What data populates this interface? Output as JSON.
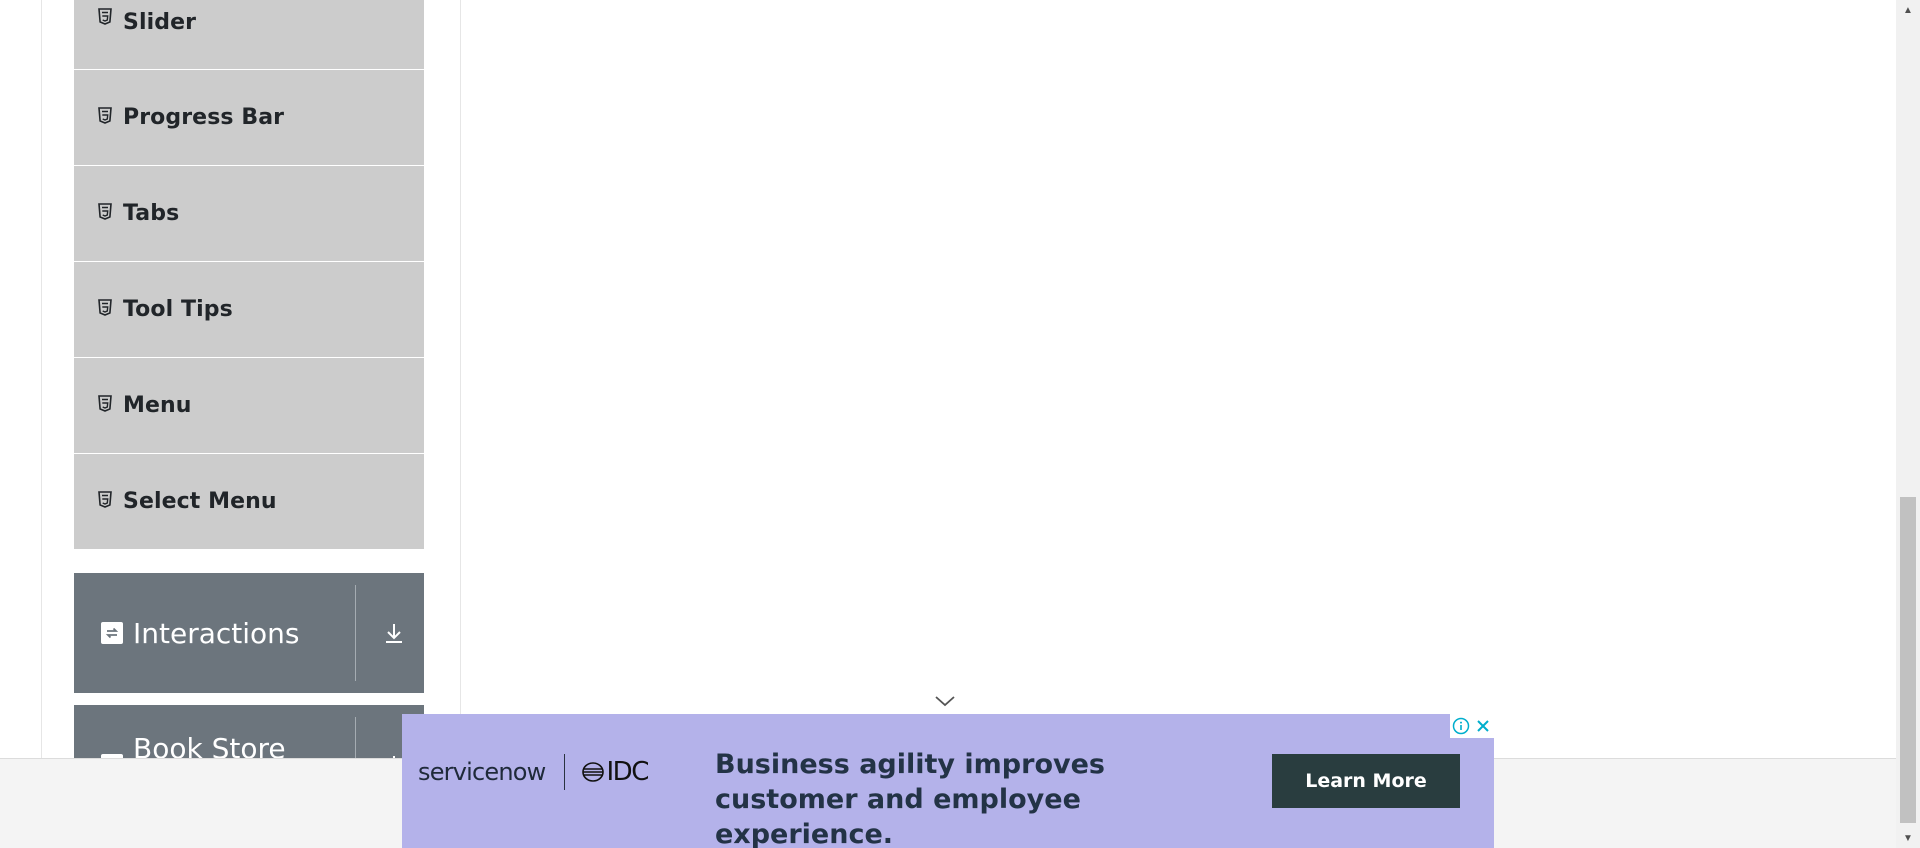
{
  "sidebar": {
    "widget_items": [
      {
        "label": "Slider",
        "icon": "html5-icon"
      },
      {
        "label": "Progress Bar",
        "icon": "html5-icon"
      },
      {
        "label": "Tabs",
        "icon": "html5-icon"
      },
      {
        "label": "Tool Tips",
        "icon": "html5-icon"
      },
      {
        "label": "Menu",
        "icon": "html5-icon"
      },
      {
        "label": "Select Menu",
        "icon": "html5-icon"
      }
    ],
    "groups": [
      {
        "label": "Interactions",
        "icon": "interactions-icon",
        "toggle_icon": "download-arrow-icon"
      },
      {
        "label": "Book Store Application",
        "icon": "book-icon",
        "toggle_icon": "download-arrow-icon"
      }
    ]
  },
  "ad": {
    "brand": "servicenow",
    "partner": "IDC",
    "headline": "Business agility improves customer and employee experience.",
    "cta_label": "Learn More",
    "background_color": "#b4b2ea",
    "cta_color": "#293d3f",
    "info_icon": "info-icon",
    "close_icon": "close-icon",
    "collapse_icon": "chevron-down-icon"
  },
  "colors": {
    "menu_item_bg": "#cccccc",
    "group_header_bg": "#6c757d"
  }
}
